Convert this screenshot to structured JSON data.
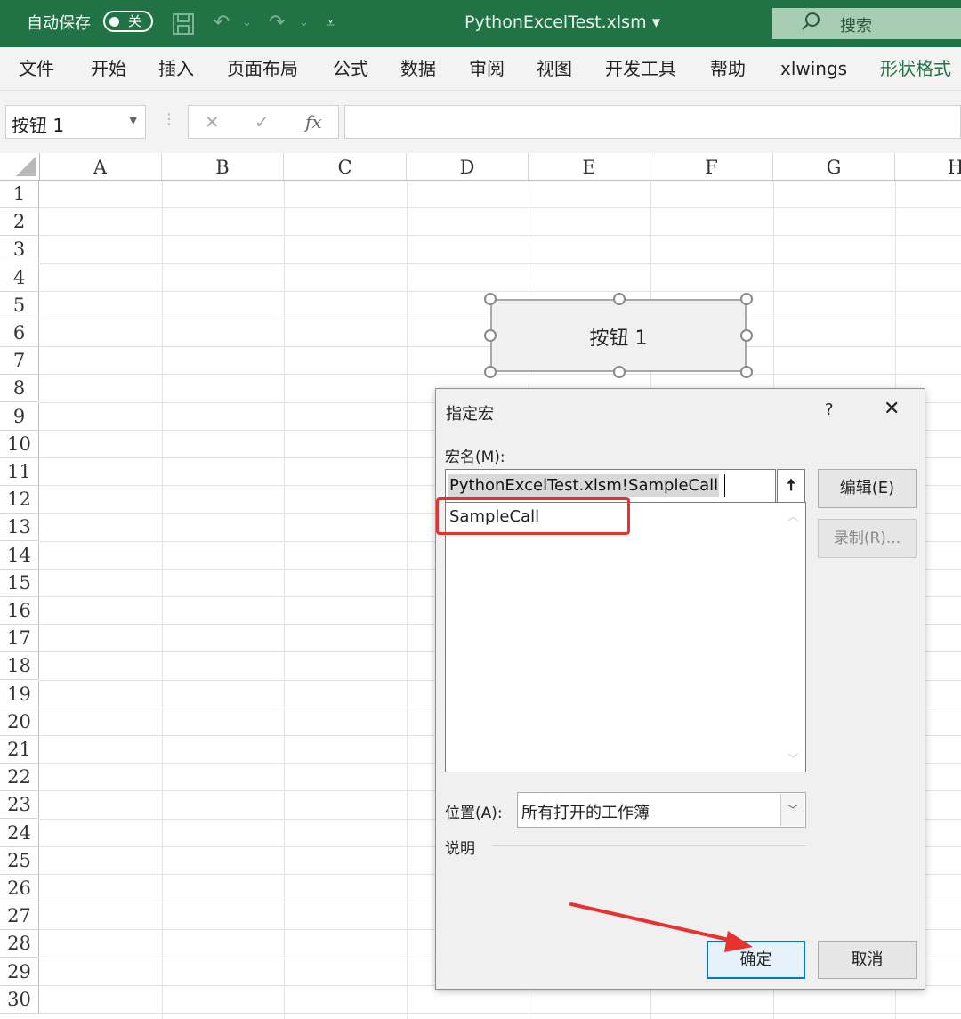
{
  "titlebar": {
    "autosave_label": "自动保存",
    "autosave_state": "关",
    "filename": "PythonExcelTest.xlsm",
    "filename_dropdown": "▾",
    "search_label": "搜索",
    "accent_color": "#217346"
  },
  "ribbon": {
    "tabs": [
      "文件",
      "开始",
      "插入",
      "页面布局",
      "公式",
      "数据",
      "审阅",
      "视图",
      "开发工具",
      "帮助",
      "xlwings",
      "形状格式"
    ],
    "active_tab": "形状格式"
  },
  "formula_bar": {
    "name_box": "按钮 1",
    "cancel_icon": "✕",
    "enter_icon": "✓",
    "fx_label": "fx",
    "formula": ""
  },
  "sheet": {
    "columns": [
      "A",
      "B",
      "C",
      "D",
      "E",
      "F",
      "G",
      "H"
    ],
    "rows": [
      "1",
      "2",
      "3",
      "4",
      "5",
      "6",
      "7",
      "8",
      "9",
      "10",
      "11",
      "12",
      "13",
      "14",
      "15",
      "16",
      "17",
      "18",
      "19",
      "20",
      "21",
      "22",
      "23",
      "24",
      "25",
      "26",
      "27",
      "28",
      "29",
      "30"
    ]
  },
  "shape": {
    "label": "按钮 1"
  },
  "dialog": {
    "title": "指定宏",
    "help": "?",
    "close": "✕",
    "macro_name_label": "宏名(M):",
    "macro_name_value": "PythonExcelTest.xlsm!SampleCall",
    "macro_list": [
      "SampleCall"
    ],
    "edit_button": "编辑(E)",
    "record_button": "录制(R)...",
    "location_label": "位置(A):",
    "location_value": "所有打开的工作簿",
    "description_label": "说明",
    "ok_button": "确定",
    "cancel_button": "取消"
  },
  "annotation": {
    "highlight_color": "#e8322f"
  }
}
